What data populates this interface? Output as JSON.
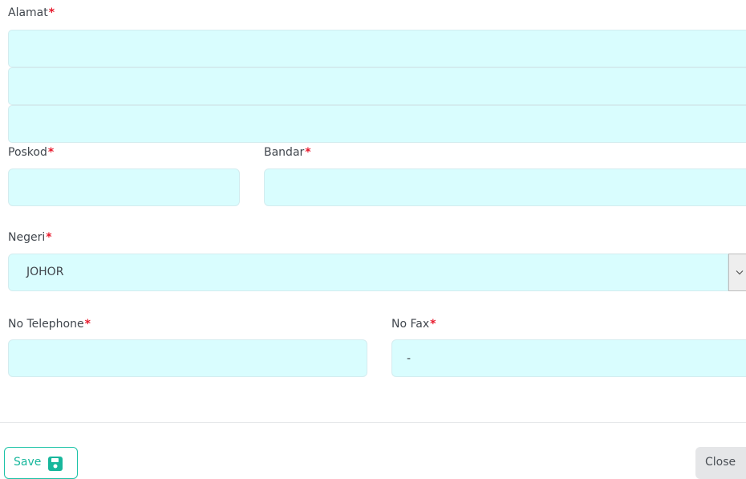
{
  "form": {
    "alamat": {
      "label": "Alamat",
      "required_mark": "*",
      "lines": [
        "",
        "",
        ""
      ]
    },
    "poskod": {
      "label": "Poskod",
      "required_mark": "*",
      "value": ""
    },
    "bandar": {
      "label": "Bandar",
      "required_mark": "*",
      "value": ""
    },
    "negeri": {
      "label": "Negeri",
      "required_mark": "*",
      "selected": "JOHOR"
    },
    "telephone": {
      "label": "No Telephone",
      "required_mark": "*",
      "value": ""
    },
    "fax": {
      "label": "No Fax",
      "required_mark": "*",
      "value": "-"
    }
  },
  "footer": {
    "save_label": "Save",
    "close_label": "Close"
  },
  "icons": {
    "save": "floppy-disk-icon",
    "dropdown": "chevron-down-icon"
  },
  "colors": {
    "field_bg": "#d9fdfe",
    "required": "#e8192c",
    "save_accent": "#18b79c",
    "close_bg": "#e5e6e8"
  }
}
